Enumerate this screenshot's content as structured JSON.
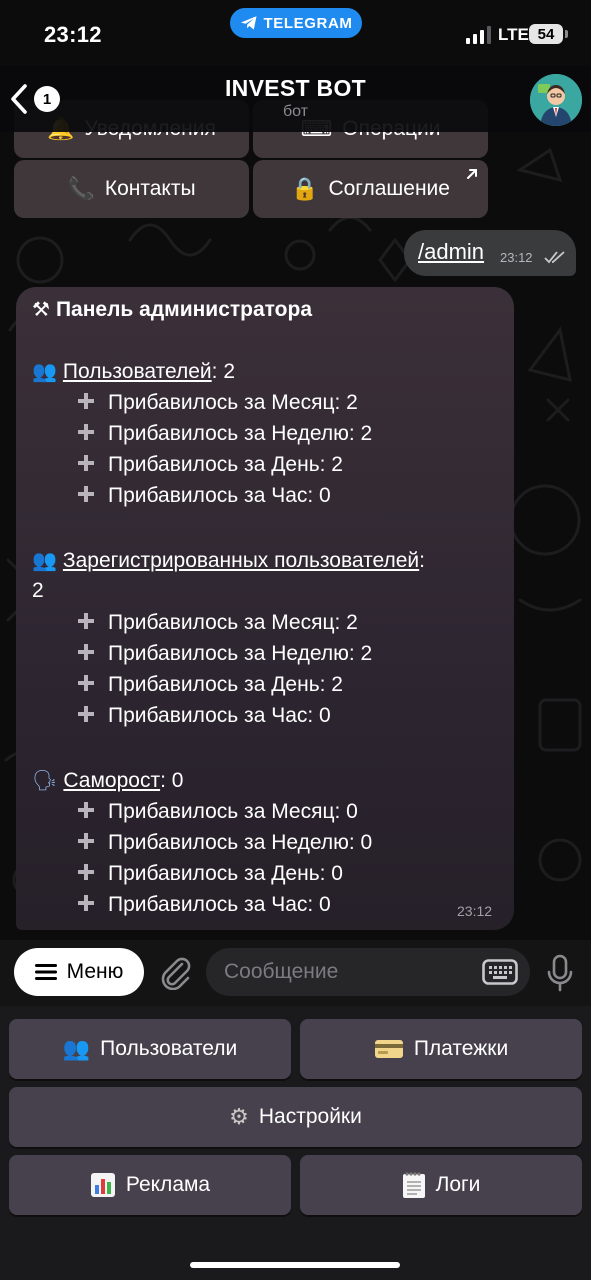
{
  "status_bar": {
    "time": "23:12",
    "telegram_label": "TELEGRAM",
    "network": "LTE",
    "battery": "54"
  },
  "header": {
    "back_count": "1",
    "title": "INVEST BOT",
    "subtitle": "бот"
  },
  "inline_keyboard": {
    "partial_row": [
      {
        "label": "Уведомления",
        "icon": "bell-icon"
      },
      {
        "label": "Операции",
        "icon": "keyboard-icon"
      }
    ],
    "row": [
      {
        "label": "Контакты",
        "icon": "phone-icon"
      },
      {
        "label": "Соглашение",
        "icon": "lock-icon",
        "external": true
      }
    ]
  },
  "outgoing": {
    "text": "/admin",
    "time": "23:12"
  },
  "admin_message": {
    "title": "Панель администратора",
    "title_icon": "hammer-pick-icon",
    "sections": [
      {
        "icon": "users-icon",
        "label": "Пользователей",
        "value": "2",
        "stats": [
          "Прибавилось за Месяц: 2",
          "Прибавилось за Неделю: 2",
          "Прибавилось за День: 2",
          "Прибавилось за Час: 0"
        ]
      },
      {
        "icon": "users-icon",
        "label": "Зарегистрированных пользователей",
        "value": "2",
        "stats": [
          "Прибавилось за Месяц: 2",
          "Прибавилось за Неделю: 2",
          "Прибавилось за День: 2",
          "Прибавилось за Час: 0"
        ]
      },
      {
        "icon": "speaking-head-icon",
        "label": "Самороcт",
        "value": "0",
        "stats": [
          "Прибавилось за Месяц: 0",
          "Прибавилось за Неделю: 0",
          "Прибавилось за День: 0",
          "Прибавилось за Час: 0"
        ]
      }
    ],
    "time": "23:12"
  },
  "input_bar": {
    "menu_label": "Меню",
    "placeholder": "Сообщение"
  },
  "reply_keyboard": {
    "users": "Пользователи",
    "payments": "Платежки",
    "settings": "Настройки",
    "ads": "Реклама",
    "logs": "Логи"
  },
  "colors": {
    "telegram_blue": "#1f8bf0",
    "bubble_in": "#2e2631",
    "bubble_out": "#3a3b3d",
    "keyboard_button": "#46414c"
  }
}
